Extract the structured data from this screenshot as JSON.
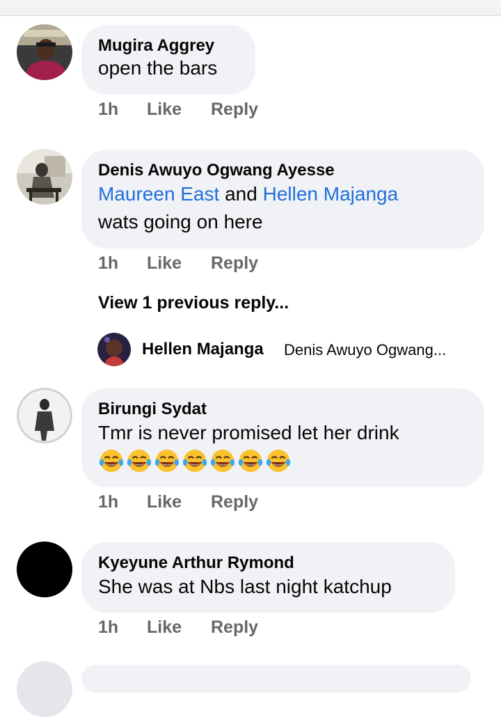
{
  "comments": [
    {
      "author": "Mugira Aggrey",
      "text": "open the bars",
      "time": "1h",
      "like": "Like",
      "reply": "Reply"
    },
    {
      "author": "Denis Awuyo Ogwang Ayesse",
      "mention1": "Maureen East",
      "joiner": "and",
      "mention2": "Hellen Majanga",
      "text": "wats going on here",
      "time": "1h",
      "like": "Like",
      "reply": "Reply",
      "view_replies": "View 1 previous reply...",
      "reply_preview": {
        "author": "Hellen Majanga",
        "snippet": "Denis Awuyo Ogwang..."
      }
    },
    {
      "author": "Birungi Sydat",
      "text": "Tmr is never promised let her drink",
      "emojis": [
        "tears-of-joy",
        "tears-of-joy",
        "tears-of-joy",
        "tears-of-joy",
        "tears-of-joy",
        "tears-of-joy",
        "tears-of-joy"
      ],
      "time": "1h",
      "like": "Like",
      "reply": "Reply"
    },
    {
      "author": "Kyeyune Arthur Rymond",
      "text": "She was at Nbs last night katchup",
      "time": "1h",
      "like": "Like",
      "reply": "Reply"
    }
  ],
  "colors": {
    "bubble": "#f0f2f5",
    "mention": "#216fdb",
    "meta": "#65676b"
  }
}
